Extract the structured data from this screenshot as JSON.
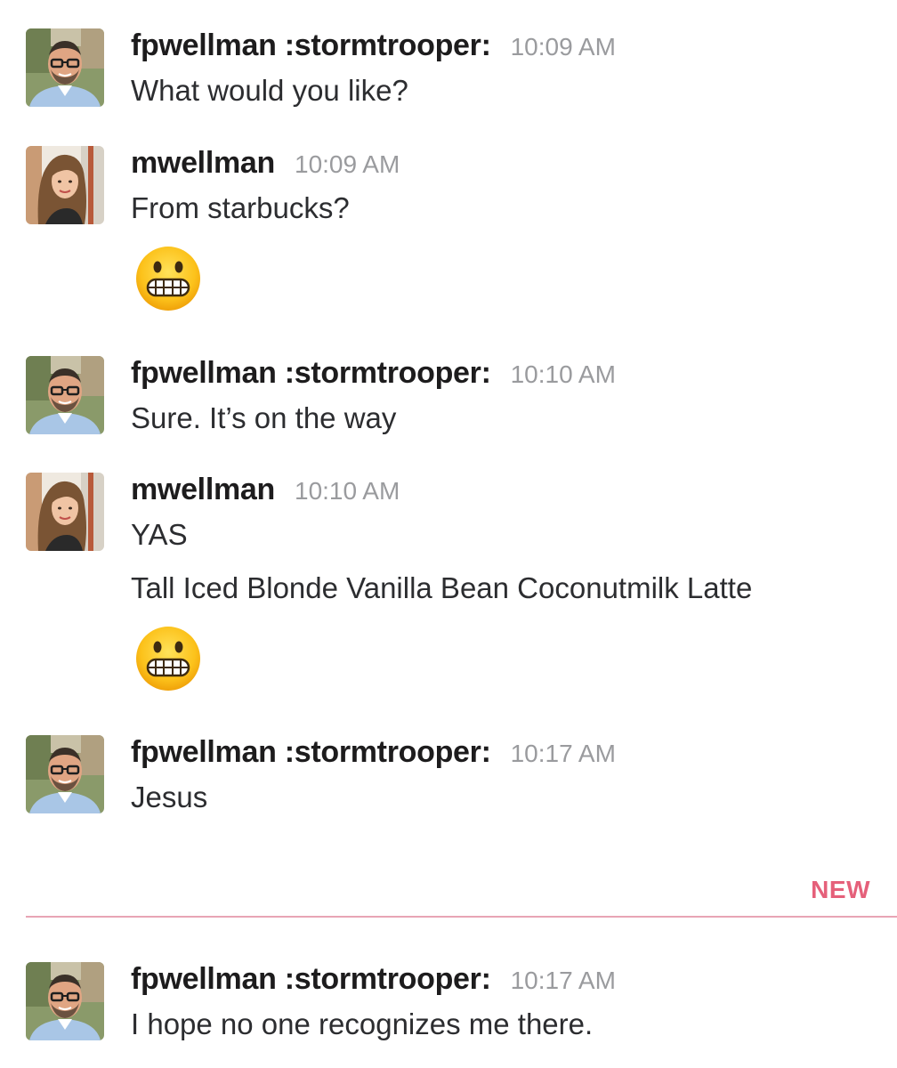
{
  "messages": [
    {
      "user": "fpwellman :stormtrooper:",
      "time": "10:09 AM",
      "avatar": "man-avatar",
      "lines": [
        "What would you like?"
      ]
    },
    {
      "user": "mwellman",
      "time": "10:09 AM",
      "avatar": "woman-avatar",
      "lines": [
        "From starbucks?"
      ],
      "emoji": "grimacing-face-emoji"
    },
    {
      "user": "fpwellman :stormtrooper:",
      "time": "10:10 AM",
      "avatar": "man-avatar",
      "lines": [
        "Sure. It’s on the way"
      ]
    },
    {
      "user": "mwellman",
      "time": "10:10 AM",
      "avatar": "woman-avatar",
      "lines": [
        "YAS",
        "Tall Iced Blonde Vanilla Bean Coconutmilk Latte"
      ],
      "emoji": "grimacing-face-emoji"
    },
    {
      "user": "fpwellman :stormtrooper:",
      "time": "10:17 AM",
      "avatar": "man-avatar",
      "lines": [
        "Jesus"
      ]
    },
    {
      "user": "fpwellman :stormtrooper:",
      "time": "10:17 AM",
      "avatar": "man-avatar",
      "lines": [
        "I hope no one recognizes me there."
      ]
    }
  ],
  "divider": {
    "label": "NEW",
    "color": "#e5607a"
  }
}
